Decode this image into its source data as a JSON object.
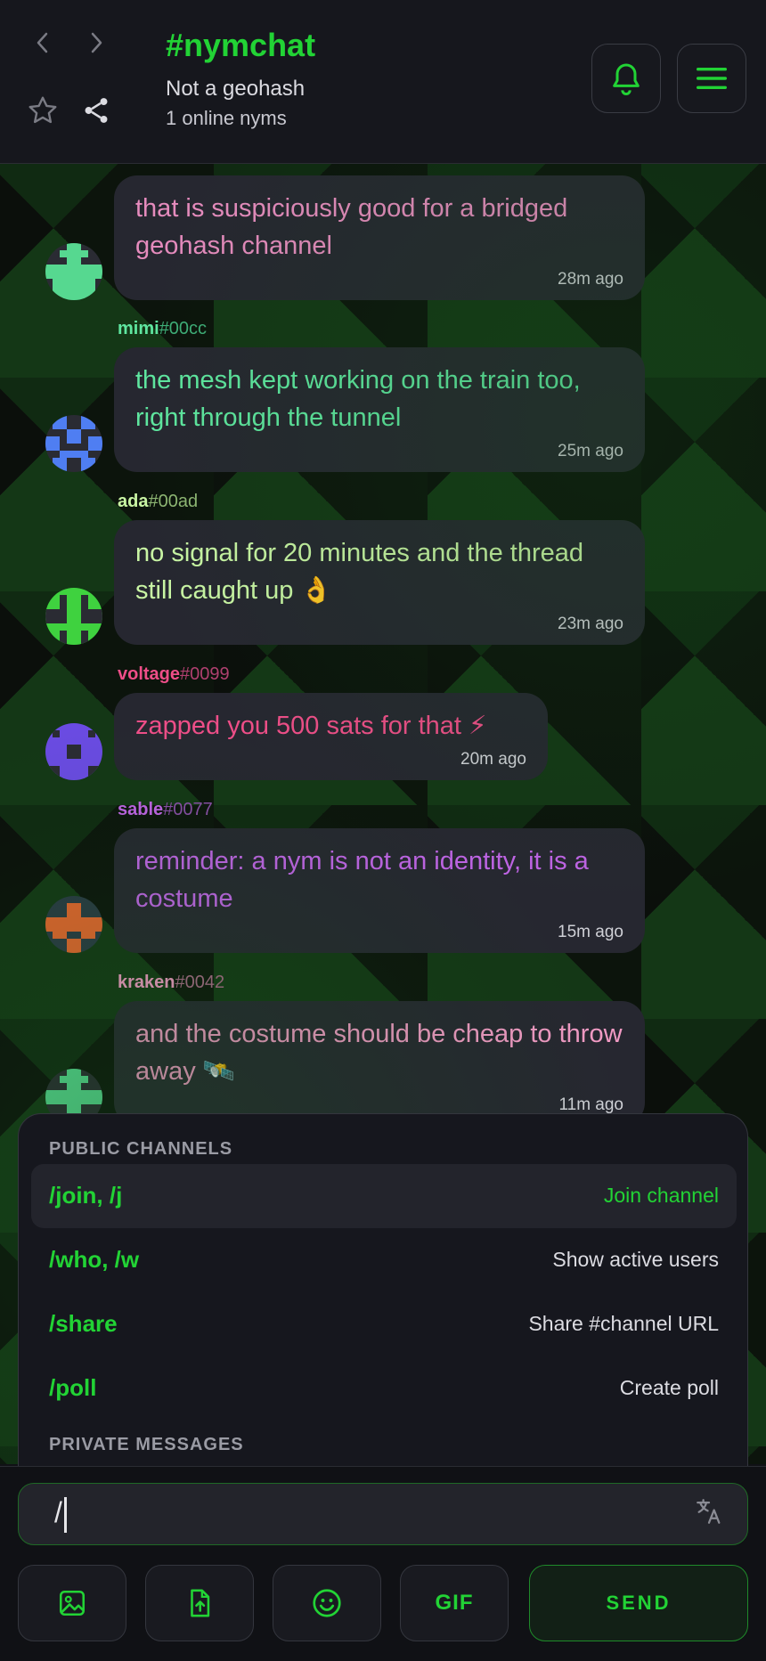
{
  "header": {
    "title": "#nymchat",
    "subtitle": "Not a geohash",
    "online": "1 online nyms"
  },
  "messages": [
    {
      "author": "",
      "tag": "",
      "text": "that is suspiciously good for a bridged geohash channel",
      "time": "28m ago",
      "color": "#e58bbd",
      "avatar_color": "#56d890"
    },
    {
      "author": "mimi",
      "tag": "#00cc",
      "text": "the mesh kept working on the train too, right through the tunnel",
      "time": "25m ago",
      "color": "#5fe7a0",
      "avatar_color": "#4f7ef2"
    },
    {
      "author": "ada",
      "tag": "#00ad",
      "text": "no signal for 20 minutes and the thread still caught up 👌",
      "time": "23m ago",
      "color": "#c9f5a4",
      "avatar_color": "#3fd23f"
    },
    {
      "author": "voltage",
      "tag": "#0099",
      "text": "zapped you 500 sats for that ⚡",
      "time": "20m ago",
      "color": "#ee4e88",
      "avatar_color": "#6a4be2"
    },
    {
      "author": "sable",
      "tag": "#0077",
      "text": "reminder: a nym is not an identity, it is a costume",
      "time": "15m ago",
      "color": "#c064e6",
      "avatar_color": "#e2652e"
    },
    {
      "author": "kraken",
      "tag": "#0042",
      "text": "and the costume should be cheap to throw away 🛰️",
      "time": "11m ago",
      "color": "#f19ac4",
      "avatar_color": "#56d890"
    }
  ],
  "commands": {
    "public_label": "PUBLIC CHANNELS",
    "items": [
      {
        "name": "/join, /j",
        "desc": "Join channel"
      },
      {
        "name": "/who, /w",
        "desc": "Show active users"
      },
      {
        "name": "/share",
        "desc": "Share #channel URL"
      },
      {
        "name": "/poll",
        "desc": "Create poll"
      }
    ],
    "private_label": "PRIVATE MESSAGES"
  },
  "input": {
    "value": "/"
  },
  "toolbar": {
    "gif_label": "GIF",
    "send_label": "SEND"
  },
  "colors": {
    "accent": "#22d335"
  }
}
